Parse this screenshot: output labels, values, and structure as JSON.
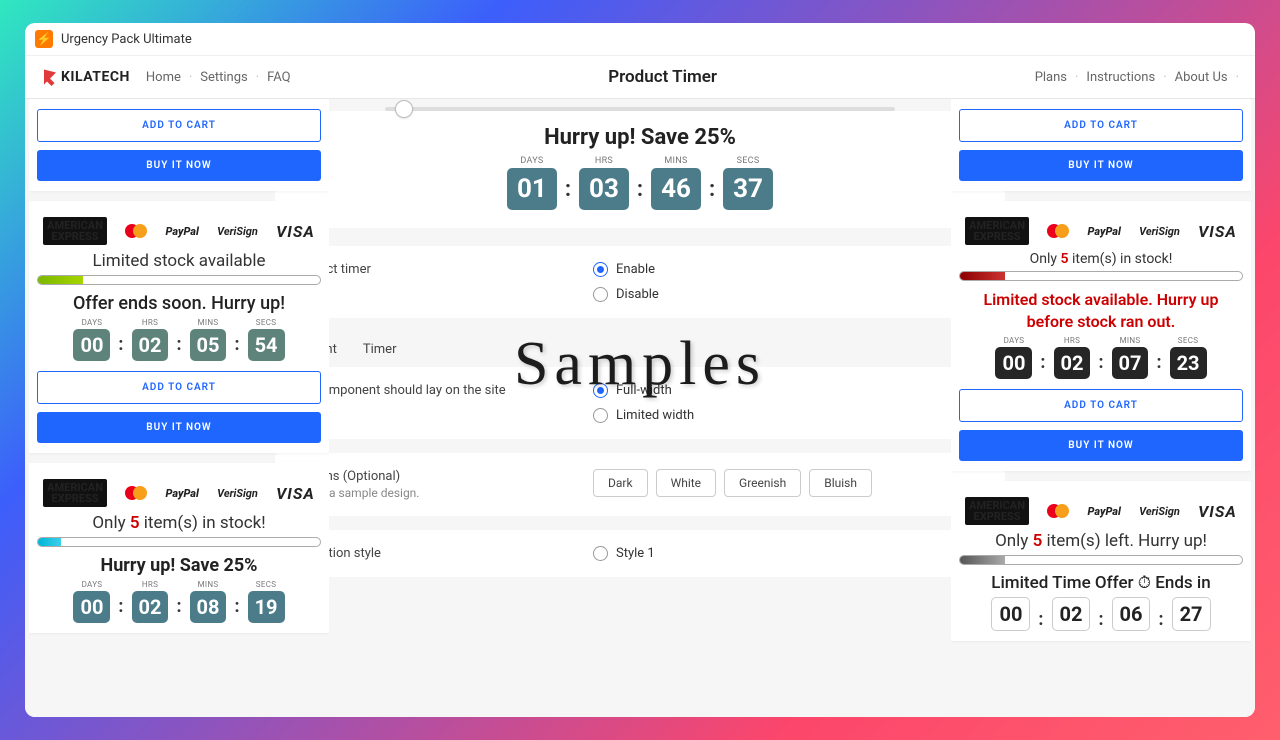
{
  "app": {
    "name": "Urgency Pack Ultimate",
    "brand": "KILATECH"
  },
  "nav": {
    "left": [
      "Home",
      "Settings",
      "FAQ"
    ],
    "title": "Product Timer",
    "right": [
      "Plans",
      "Instructions",
      "About Us"
    ]
  },
  "overlay_label": "Samples",
  "preview": {
    "title": "Hurry up! Save 25%",
    "labels": {
      "days": "DAYS",
      "hrs": "HRS",
      "mins": "MINS",
      "secs": "SECS"
    },
    "values": {
      "days": "01",
      "hrs": "03",
      "mins": "46",
      "secs": "37"
    }
  },
  "settings": {
    "status": {
      "caption": "product timer",
      "options": {
        "enable": "Enable",
        "disable": "Disable"
      }
    },
    "tabs": {
      "placement": "Placement",
      "timer": "Timer"
    },
    "width": {
      "caption": "the component should lay on the site",
      "options": {
        "full": "Full-width",
        "limited": "Limited width"
      }
    },
    "designs": {
      "title": "Designs (Optional)",
      "sub": "Select a sample design.",
      "chips": [
        "Dark",
        "White",
        "Greenish",
        "Bluish"
      ]
    },
    "transition": {
      "title": "Transition style",
      "option": "Style 1"
    }
  },
  "buttons": {
    "add": "ADD TO CART",
    "buy": "BUY IT NOW"
  },
  "pay": {
    "amex1": "AMERICAN",
    "amex2": "EXPRESS",
    "paypal": "PayPal",
    "verisign": "VeriSign",
    "visa": "VISA"
  },
  "samples": {
    "l1": {
      "stock": "Limited stock available",
      "offer": "Offer ends soon. Hurry up!",
      "t": {
        "d": "00",
        "h": "02",
        "m": "05",
        "s": "54"
      }
    },
    "l2": {
      "stock_a": "Only ",
      "stock_n": "5",
      "stock_b": " item(s) in stock!",
      "offer": "Hurry up! Save 25%",
      "t": {
        "d": "00",
        "h": "02",
        "m": "08",
        "s": "19"
      }
    },
    "r1": {
      "stock_a": "Only ",
      "stock_n": "5",
      "stock_b": " item(s) in stock!",
      "offer": "Limited stock available. Hurry up before stock ran out.",
      "t": {
        "d": "00",
        "h": "02",
        "m": "07",
        "s": "23"
      }
    },
    "r2": {
      "stock_a": "Only ",
      "stock_n": "5",
      "stock_b": " item(s) left. Hurry up!",
      "offer_a": "Limited Time Offer ",
      "offer_b": " Ends in",
      "t": {
        "d": "00",
        "h": "02",
        "m": "06",
        "s": "27"
      }
    }
  }
}
